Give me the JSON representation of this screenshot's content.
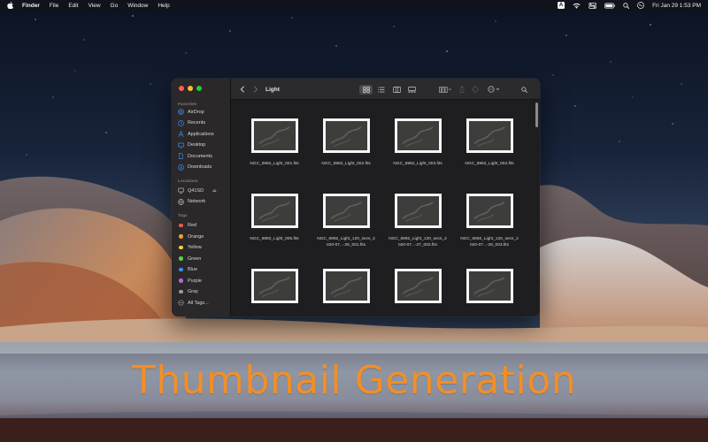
{
  "menubar": {
    "app_name": "Finder",
    "menus": [
      "File",
      "Edit",
      "View",
      "Go",
      "Window",
      "Help"
    ],
    "status": {
      "input_source": "A",
      "clock": "Fri Jan 29  1:53 PM"
    }
  },
  "window": {
    "title": "Light",
    "sidebar": {
      "favorites_header": "Favorites",
      "favorites": [
        {
          "label": "AirDrop",
          "icon": "airdrop-icon"
        },
        {
          "label": "Recents",
          "icon": "clock-icon"
        },
        {
          "label": "Applications",
          "icon": "applications-icon"
        },
        {
          "label": "Desktop",
          "icon": "desktop-icon"
        },
        {
          "label": "Documents",
          "icon": "document-icon"
        },
        {
          "label": "Downloads",
          "icon": "download-icon"
        }
      ],
      "locations_header": "Locations",
      "locations": [
        {
          "label": "Q41SD",
          "icon": "drive-icon",
          "eject": "⏏"
        },
        {
          "label": "Network",
          "icon": "network-icon"
        }
      ],
      "tags_header": "Tags",
      "tags": [
        {
          "label": "Red",
          "color": "#f0574f"
        },
        {
          "label": "Orange",
          "color": "#f39a35"
        },
        {
          "label": "Yellow",
          "color": "#f5cf3c"
        },
        {
          "label": "Green",
          "color": "#5ccd4f"
        },
        {
          "label": "Blue",
          "color": "#3a8ef7"
        },
        {
          "label": "Purple",
          "color": "#b866d8"
        },
        {
          "label": "Gray",
          "color": "#9c9c9f"
        },
        {
          "label": "All Tags...",
          "icon": "all-tags-icon"
        }
      ]
    },
    "files": [
      {
        "name": "NGC_6992_Light_001.fits"
      },
      {
        "name": "NGC_6992_Light_002.fits"
      },
      {
        "name": "NGC_6992_Light_003.fits"
      },
      {
        "name": "NGC_6992_Light_004.fits"
      },
      {
        "name": "NGC_6992_Light_005.fits"
      },
      {
        "name": "NGC_6992_Light_120_secs_2020-07...-26_001.fits"
      },
      {
        "name": "NGC_6992_Light_120_secs_2020-07...-27_002.fits"
      },
      {
        "name": "NGC_6992_Light_120_secs_2020-07...-29_003.fits"
      },
      {
        "name": ""
      },
      {
        "name": ""
      },
      {
        "name": ""
      },
      {
        "name": ""
      }
    ]
  },
  "banner": {
    "text": "Thumbnail Generation"
  },
  "colors": {
    "accent_text": "#f08f2a",
    "close": "#fe5f57",
    "minimize": "#febc2e",
    "zoom": "#28c840",
    "sidebar_icon": "#3b8ef5"
  }
}
